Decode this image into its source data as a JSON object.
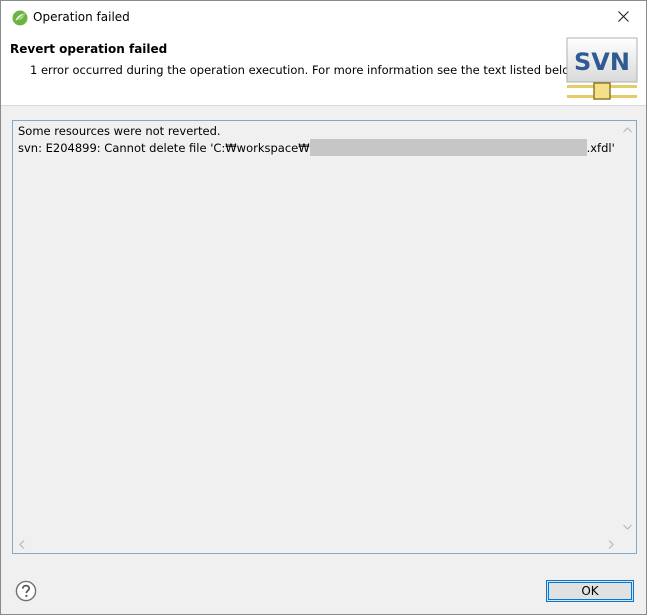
{
  "window": {
    "title": "Operation failed"
  },
  "header": {
    "title": "Revert operation failed",
    "message": "1 error occurred during the operation execution. For more information see the text listed below.",
    "logo_text": "SVN"
  },
  "details": {
    "line1": "Some resources were not reverted.",
    "line2_prefix": "svn: E204899: Cannot delete file 'C:₩workspace₩",
    "line2_suffix": ".xfdl'"
  },
  "footer": {
    "ok_label": "OK"
  },
  "colors": {
    "accent": "#0078d7",
    "details_border": "#82a9c8"
  },
  "icons": {
    "app": "eclipse-leaf-icon",
    "close": "close-icon",
    "help": "help-icon",
    "logo": "svn-logo-icon"
  }
}
